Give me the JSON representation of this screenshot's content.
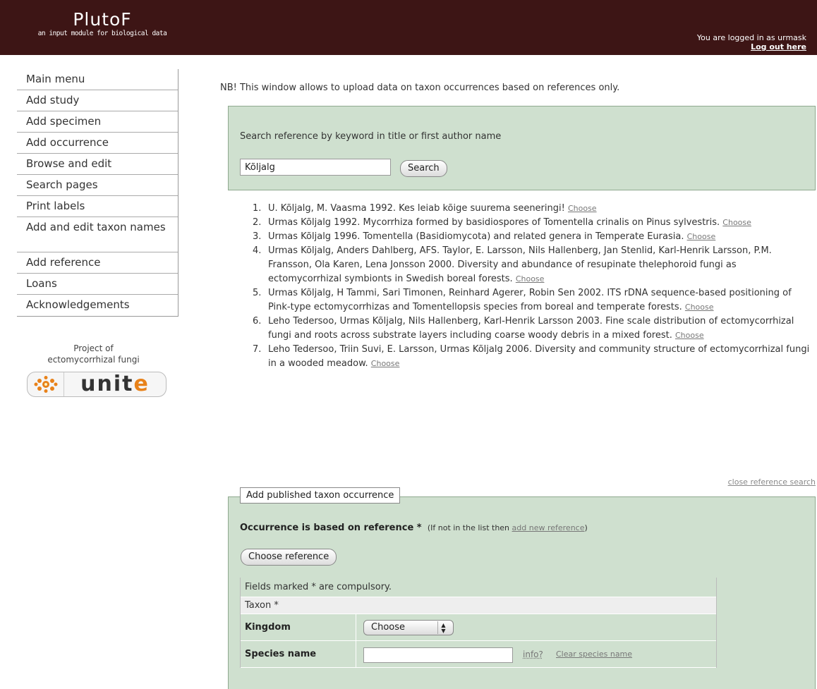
{
  "header": {
    "app_title": "PlutoF",
    "app_subtitle": "an input module for biological data",
    "login_text": "You are logged in as urmask",
    "logout_link": "Log out here"
  },
  "sidebar": {
    "items": [
      {
        "label": "Main menu"
      },
      {
        "label": "Add study"
      },
      {
        "label": "Add specimen"
      },
      {
        "label": "Add occurrence"
      },
      {
        "label": "Browse and edit"
      },
      {
        "label": "Search pages"
      },
      {
        "label": "Print labels"
      },
      {
        "label": "Add and edit taxon names"
      },
      {
        "label": "Add reference"
      },
      {
        "label": "Loans"
      },
      {
        "label": "Acknowledgements"
      }
    ],
    "project_line1": "Project of",
    "project_line2": "ectomycorrhizal fungi",
    "unite_logo_text": "unit",
    "unite_logo_e": "e"
  },
  "main": {
    "notice": "NB! This window allows to upload data on taxon occurrences based on references only.",
    "search": {
      "label": "Search reference by keyword in title or first author name",
      "value": "Kõljalg",
      "button": "Search"
    },
    "choose_label": "Choose",
    "references": [
      {
        "num": "1.",
        "text": "U. Kõljalg, M. Vaasma 1992. Kes leiab kõige suurema seeneringi! "
      },
      {
        "num": "2.",
        "text": "Urmas Kõljalg 1992. Mycorrhiza formed by basidiospores of Tomentella crinalis on Pinus sylvestris. "
      },
      {
        "num": "3.",
        "text": "Urmas Kõljalg 1996. Tomentella (Basidiomycota) and related genera in Temperate Eurasia. "
      },
      {
        "num": "4.",
        "text": "Urmas Kõljalg, Anders Dahlberg, AFS. Taylor, E. Larsson, Nils Hallenberg, Jan Stenlid, Karl-Henrik Larsson, P.M. Fransson, Ola Karen, Lena Jonsson 2000. Diversity and abundance of resupinate thelephoroid fungi as ectomycorrhizal symbionts in Swedish boreal forests. "
      },
      {
        "num": "5.",
        "text": "Urmas Kõljalg, H Tammi, Sari Timonen, Reinhard Agerer, Robin Sen 2002. ITS rDNA sequence-based positioning of Pink-type ectomycorrhizas and Tomentellopsis species from boreal and temperate forests. "
      },
      {
        "num": "6.",
        "text": "Leho Tedersoo, Urmas Kõljalg, Nils Hallenberg, Karl-Henrik Larsson 2003. Fine scale distribution of ectomycorrhizal fungi and roots across substrate layers including coarse woody debris in a mixed forest. "
      },
      {
        "num": "7.",
        "text": "Leho Tedersoo, Triin Suvi, E. Larsson, Urmas Kõljalg 2006. Diversity and community structure of ectomycorrhizal fungi in a wooded meadow. "
      }
    ],
    "close_search": "close reference search",
    "occurrence_form": {
      "legend": "Add published taxon occurrence",
      "based_on_label": "Occurrence is based on reference *",
      "not_in_list": "(If not in the list then ",
      "add_new_reference": "add new reference",
      "not_in_list_end": ")",
      "choose_reference_button": "Choose reference",
      "compulsory_note": "Fields marked * are compulsory.",
      "taxon_heading": "Taxon *",
      "kingdom_label": "Kingdom",
      "kingdom_selected": "Choose",
      "species_label": "Species name",
      "species_value": "",
      "info_link": "info?",
      "clear_species_link": "Clear species name"
    }
  },
  "colors": {
    "header_bg": "#3d1515",
    "panel_bg": "#cfe0cf",
    "panel_border": "#8fa98f",
    "logo_accent": "#e8821a"
  },
  "icons": {
    "unite_star": "orange-fungus-star-icon",
    "select_arrows": "up-down-arrows-icon"
  }
}
